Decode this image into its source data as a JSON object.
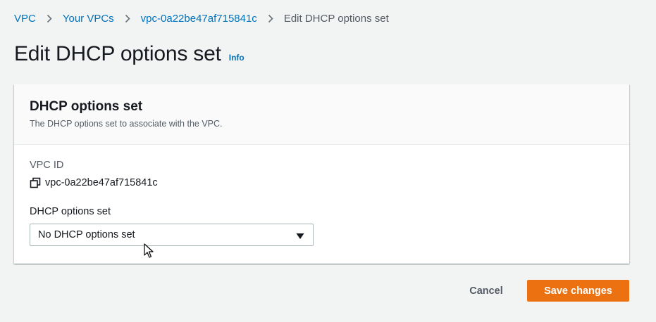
{
  "breadcrumb": {
    "items": [
      {
        "label": "VPC"
      },
      {
        "label": "Your VPCs"
      },
      {
        "label": "vpc-0a22be47af715841c"
      },
      {
        "label": "Edit DHCP options set"
      }
    ]
  },
  "page": {
    "title": "Edit DHCP options set",
    "info_label": "Info"
  },
  "panel": {
    "title": "DHCP options set",
    "description": "The DHCP options set to associate with the VPC.",
    "vpc_id_label": "VPC ID",
    "vpc_id_value": "vpc-0a22be47af715841c",
    "select_label": "DHCP options set",
    "select_value": "No DHCP options set"
  },
  "actions": {
    "cancel_label": "Cancel",
    "save_label": "Save changes"
  },
  "colors": {
    "link": "#0073bb",
    "primary_button": "#ec7211",
    "background": "#f2f3f3"
  },
  "icons": {
    "separator": "chevron-right-icon",
    "copy": "copy-icon",
    "select": "caret-down-icon",
    "pointer": "mouse-cursor-icon"
  }
}
